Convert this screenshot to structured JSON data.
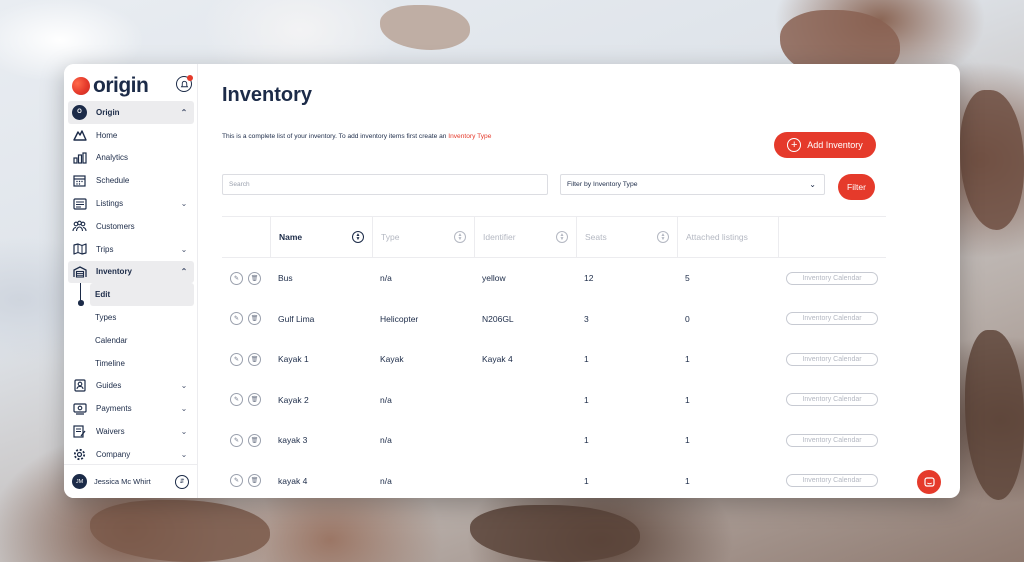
{
  "brand": {
    "name": "origin"
  },
  "sidebar": {
    "org": {
      "badge": "O",
      "label": "Origin"
    },
    "items": [
      {
        "label": "Home",
        "icon": "mountain-icon"
      },
      {
        "label": "Analytics",
        "icon": "bar-chart-icon"
      },
      {
        "label": "Schedule",
        "icon": "calendar-icon"
      },
      {
        "label": "Listings",
        "icon": "list-icon"
      },
      {
        "label": "Customers",
        "icon": "people-icon"
      },
      {
        "label": "Trips",
        "icon": "map-icon"
      },
      {
        "label": "Inventory",
        "icon": "warehouse-icon"
      }
    ],
    "inventory_sub": [
      "Edit",
      "Types",
      "Calendar",
      "Timeline"
    ],
    "items_after": [
      {
        "label": "Guides",
        "icon": "id-card-icon"
      },
      {
        "label": "Payments",
        "icon": "payment-icon"
      },
      {
        "label": "Waivers",
        "icon": "document-icon"
      },
      {
        "label": "Company",
        "icon": "gear-icon"
      }
    ],
    "user": {
      "initials": "JM",
      "name": "Jessica Mc Whirt"
    }
  },
  "main": {
    "title": "Inventory",
    "intro_text": "This is a complete list of your inventory. To add inventory items first create an ",
    "intro_link": "Inventory Type",
    "add_button": "Add Inventory",
    "search_placeholder": "Search",
    "filter_select": "Filter by Inventory Type",
    "filter_button": "Filter"
  },
  "table": {
    "columns": [
      "Name",
      "Type",
      "Identifier",
      "Seats",
      "Attached listings"
    ],
    "rows": [
      {
        "name": "Bus",
        "type": "n/a",
        "identifier": "yellow",
        "seats": "12",
        "attached": "5"
      },
      {
        "name": "Gulf Lima",
        "type": "Helicopter",
        "identifier": "N206GL",
        "seats": "3",
        "attached": "0"
      },
      {
        "name": "Kayak 1",
        "type": "Kayak",
        "identifier": "Kayak 4",
        "seats": "1",
        "attached": "1"
      },
      {
        "name": "Kayak 2",
        "type": "n/a",
        "identifier": "",
        "seats": "1",
        "attached": "1"
      },
      {
        "name": "kayak 3",
        "type": "n/a",
        "identifier": "",
        "seats": "1",
        "attached": "1"
      },
      {
        "name": "kayak 4",
        "type": "n/a",
        "identifier": "",
        "seats": "1",
        "attached": "1"
      }
    ],
    "row_action_label": "Inventory Calendar"
  },
  "colors": {
    "accent": "#e53a2b",
    "navy": "#1c2b48"
  }
}
